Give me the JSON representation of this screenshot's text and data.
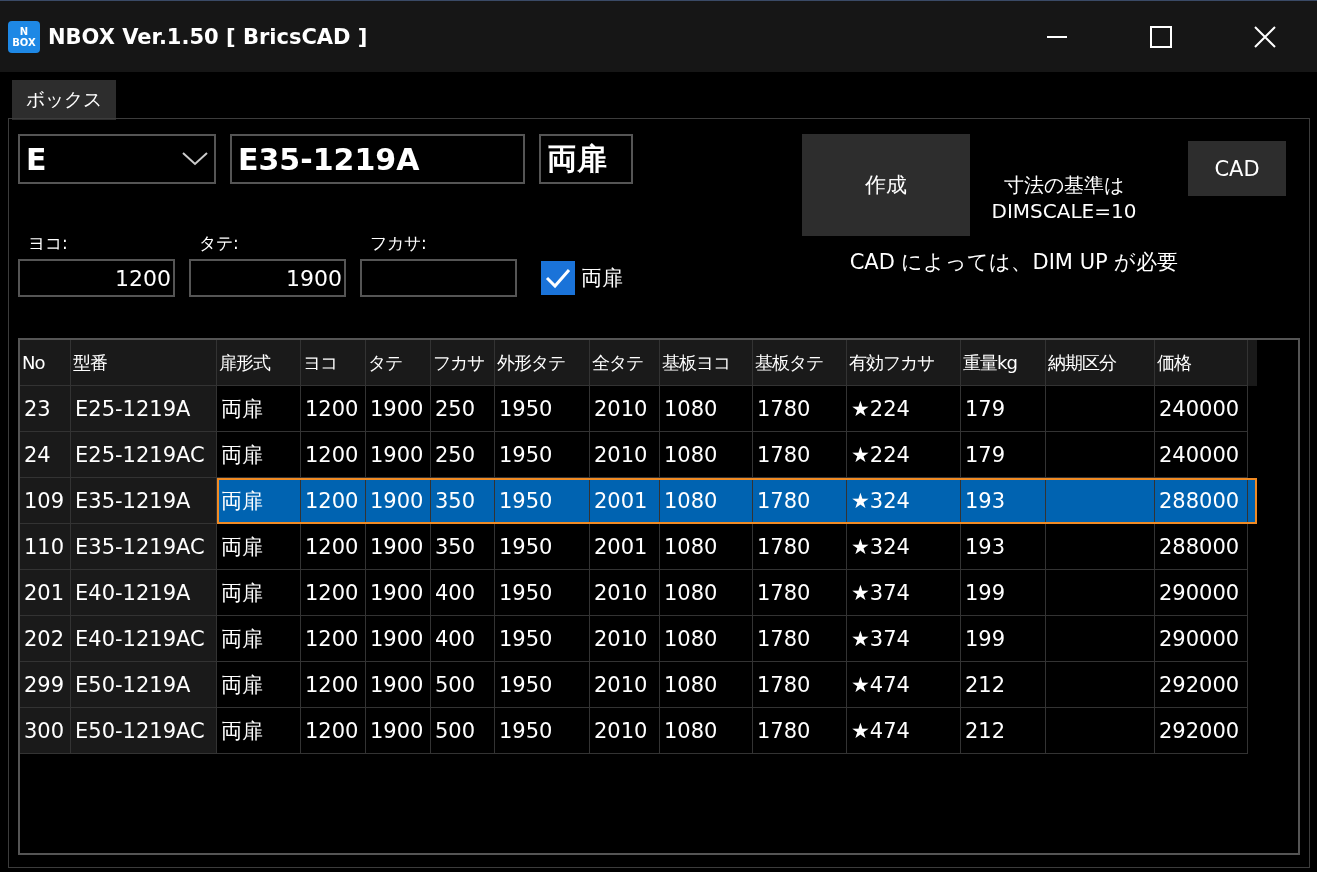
{
  "window": {
    "title": "NBOX Ver.1.50 [ BricsCAD ]",
    "logo_lines": [
      "N",
      "BOX"
    ]
  },
  "tabs": [
    {
      "label": "ボックス",
      "selected": true
    }
  ],
  "series_select": {
    "value": "E"
  },
  "model_field": {
    "value": "E35-1219A"
  },
  "door_field": {
    "value": "両扉"
  },
  "create_button": "作成",
  "dim_note": [
    "寸法の基準は",
    "DIMSCALE=10"
  ],
  "cad_button": "CAD",
  "cad_note": "CAD によっては、DIM UP が必要",
  "size_fields": [
    {
      "label": "ヨコ:",
      "value": "1200"
    },
    {
      "label": "タテ:",
      "value": "1900"
    },
    {
      "label": "フカサ:"
    }
  ],
  "double_door_checkbox": {
    "label": "両扉",
    "checked": true
  },
  "table": {
    "columns": [
      "No",
      "型番",
      "扉形式",
      "ヨコ",
      "タテ",
      "フカサ",
      "外形タテ",
      "全タテ",
      "基板ヨコ",
      "基板タテ",
      "有効フカサ",
      "重量kg",
      "納期区分",
      "価格"
    ],
    "rows": [
      {
        "selected": false,
        "cells": [
          "23",
          "E25-1219A",
          "両扉",
          "1200",
          "1900",
          "250",
          "1950",
          "2010",
          "1080",
          "1780",
          "★224",
          "179",
          "",
          "240000"
        ]
      },
      {
        "selected": false,
        "cells": [
          "24",
          "E25-1219AC",
          "両扉",
          "1200",
          "1900",
          "250",
          "1950",
          "2010",
          "1080",
          "1780",
          "★224",
          "179",
          "",
          "240000"
        ]
      },
      {
        "selected": true,
        "cells": [
          "109",
          "E35-1219A",
          "両扉",
          "1200",
          "1900",
          "350",
          "1950",
          "2001",
          "1080",
          "1780",
          "★324",
          "193",
          "",
          "288000"
        ]
      },
      {
        "selected": false,
        "cells": [
          "110",
          "E35-1219AC",
          "両扉",
          "1200",
          "1900",
          "350",
          "1950",
          "2001",
          "1080",
          "1780",
          "★324",
          "193",
          "",
          "288000"
        ]
      },
      {
        "selected": false,
        "cells": [
          "201",
          "E40-1219A",
          "両扉",
          "1200",
          "1900",
          "400",
          "1950",
          "2010",
          "1080",
          "1780",
          "★374",
          "199",
          "",
          "290000"
        ]
      },
      {
        "selected": false,
        "cells": [
          "202",
          "E40-1219AC",
          "両扉",
          "1200",
          "1900",
          "400",
          "1950",
          "2010",
          "1080",
          "1780",
          "★374",
          "199",
          "",
          "290000"
        ]
      },
      {
        "selected": false,
        "cells": [
          "299",
          "E50-1219A",
          "両扉",
          "1200",
          "1900",
          "500",
          "1950",
          "2010",
          "1080",
          "1780",
          "★474",
          "212",
          "",
          "292000"
        ]
      },
      {
        "selected": false,
        "cells": [
          "300",
          "E50-1219AC",
          "両扉",
          "1200",
          "1900",
          "500",
          "1950",
          "2010",
          "1080",
          "1780",
          "★474",
          "212",
          "",
          "292000"
        ]
      }
    ]
  }
}
